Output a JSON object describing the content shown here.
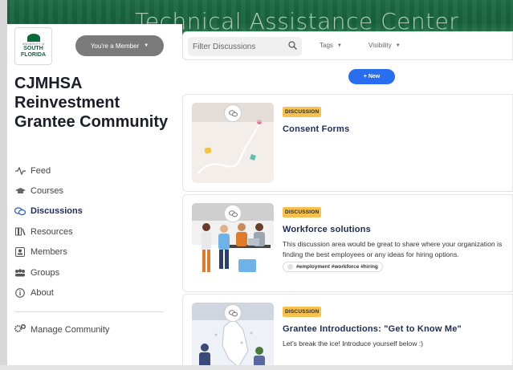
{
  "banner": {
    "title": "Technical Assistance Center"
  },
  "logo": {
    "small_text": "UNIVERSITY of",
    "line1": "SOUTH",
    "line2": "FLORIDA"
  },
  "member_button": {
    "label": "You're a Member"
  },
  "community": {
    "title": "CJMHSA Reinvestment Grantee Community"
  },
  "nav": {
    "items": [
      {
        "label": "Feed",
        "icon": "activity-icon"
      },
      {
        "label": "Courses",
        "icon": "graduation-cap-icon"
      },
      {
        "label": "Discussions",
        "icon": "chat-bubbles-icon",
        "active": true
      },
      {
        "label": "Resources",
        "icon": "books-icon"
      },
      {
        "label": "Members",
        "icon": "member-card-icon"
      },
      {
        "label": "Groups",
        "icon": "group-icon"
      },
      {
        "label": "About",
        "icon": "info-icon"
      }
    ],
    "manage": "Manage Community"
  },
  "toolbar": {
    "search_placeholder": "Filter Discussions",
    "tags_label": "Tags",
    "visibility_label": "Visibility"
  },
  "new_button": {
    "label": "+ New"
  },
  "discussions": [
    {
      "badge": "DISCUSSION",
      "title": "Consent Forms",
      "description": "",
      "tags": ""
    },
    {
      "badge": "DISCUSSION",
      "title": "Workforce solutions",
      "description": "This discussion area would be great to share where your organization is finding the best employees or any ideas for hiring options.",
      "tags": "#employment #workforce #hiring"
    },
    {
      "badge": "DISCUSSION",
      "title": "Grantee Introductions: \"Get to Know Me\"",
      "description": "Let's break the ice! Introduce yourself below :)",
      "tags": ""
    }
  ],
  "colors": {
    "banner_green": "#1f6b45",
    "accent_blue": "#2a6ef0",
    "badge_yellow": "#f6c24f",
    "title_navy": "#1c2a5a"
  }
}
